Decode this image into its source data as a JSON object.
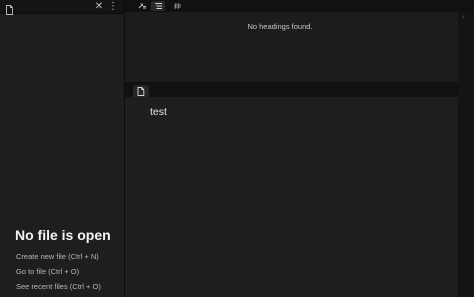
{
  "left_pane": {
    "close_glyph": "✕",
    "more_glyph": "⋮",
    "empty_state": {
      "title": "No file is open",
      "actions": [
        "Create new file (Ctrl + N)",
        "Go to file (Ctrl + O)",
        "See recent files (Ctrl + O)"
      ]
    }
  },
  "right_top_tabs": [
    {
      "icon": "backlinks-icon",
      "active": false
    },
    {
      "icon": "outline-icon",
      "active": true
    },
    {
      "icon": "tags-icon",
      "active": false
    }
  ],
  "outline": {
    "empty_message": "No headings found.",
    "chevron": "›"
  },
  "editor": {
    "tab_icon": "file-icon",
    "content": "test"
  },
  "colors": {
    "background": "#111111",
    "panel": "#1e1e1e",
    "text": "#dcddde"
  }
}
